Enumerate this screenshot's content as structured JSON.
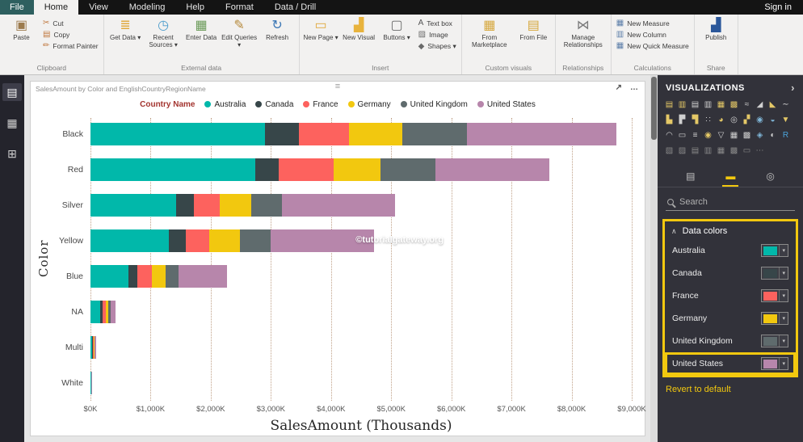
{
  "titlebar": {
    "file_tab": "File",
    "tabs": [
      "Home",
      "View",
      "Modeling",
      "Help",
      "Format",
      "Data / Drill"
    ],
    "active_tab": "Home",
    "sign_in": "Sign in"
  },
  "ribbon": {
    "groups": [
      {
        "label": "Clipboard",
        "buttons": [
          {
            "label": "Paste",
            "size": "large",
            "icon": "paste-icon",
            "glyph": "▣",
            "color": "#9c7b4e",
            "caret": false
          },
          {
            "label": "Cut",
            "size": "small",
            "icon": "cut-icon",
            "glyph": "✂",
            "color": "#c0773d",
            "caret": false
          },
          {
            "label": "Copy",
            "size": "small",
            "icon": "copy-icon",
            "glyph": "▤",
            "color": "#c0773d",
            "caret": false
          },
          {
            "label": "Format Painter",
            "size": "small",
            "icon": "format-painter-icon",
            "glyph": "✏",
            "color": "#c0773d",
            "caret": false
          }
        ]
      },
      {
        "label": "External data",
        "buttons": [
          {
            "label": "Get Data",
            "size": "large",
            "icon": "get-data-icon",
            "glyph": "≣",
            "color": "#e0a93e",
            "caret": true
          },
          {
            "label": "Recent Sources",
            "size": "large",
            "icon": "recent-sources-icon",
            "glyph": "◷",
            "color": "#4a9ccc",
            "caret": true
          },
          {
            "label": "Enter Data",
            "size": "large",
            "icon": "enter-data-icon",
            "glyph": "▦",
            "color": "#6a9a58",
            "caret": false
          },
          {
            "label": "Edit Queries",
            "size": "large",
            "icon": "edit-queries-icon",
            "glyph": "✎",
            "color": "#b5893a",
            "caret": true
          },
          {
            "label": "Refresh",
            "size": "large",
            "icon": "refresh-icon",
            "glyph": "↻",
            "color": "#3a76b5",
            "caret": false
          }
        ]
      },
      {
        "label": "Insert",
        "buttons": [
          {
            "label": "New Page",
            "size": "large",
            "icon": "new-page-icon",
            "glyph": "▭",
            "color": "#e0a93e",
            "caret": true
          },
          {
            "label": "New Visual",
            "size": "large",
            "icon": "new-visual-icon",
            "glyph": "▟",
            "color": "#e8b33d",
            "caret": false
          },
          {
            "label": "Buttons",
            "size": "large",
            "icon": "buttons-icon",
            "glyph": "▢",
            "color": "#6a6a6a",
            "caret": true
          },
          {
            "label": "Text box",
            "size": "small",
            "icon": "text-box-icon",
            "glyph": "A",
            "color": "#555555",
            "caret": false
          },
          {
            "label": "Image",
            "size": "small",
            "icon": "image-icon",
            "glyph": "▨",
            "color": "#6a6a6a",
            "caret": false
          },
          {
            "label": "Shapes",
            "size": "small",
            "icon": "shapes-icon",
            "glyph": "◆",
            "color": "#6a6a6a",
            "caret": true
          }
        ]
      },
      {
        "label": "Custom visuals",
        "buttons": [
          {
            "label": "From Marketplace",
            "size": "large",
            "icon": "from-marketplace-icon",
            "glyph": "▦",
            "color": "#d6a73c",
            "caret": false
          },
          {
            "label": "From File",
            "size": "large",
            "icon": "from-file-icon",
            "glyph": "▤",
            "color": "#d6a73c",
            "caret": false
          }
        ]
      },
      {
        "label": "Relationships",
        "buttons": [
          {
            "label": "Manage Relationships",
            "size": "large",
            "icon": "manage-relationships-icon",
            "glyph": "⋈",
            "color": "#7a7a7a",
            "caret": false
          }
        ]
      },
      {
        "label": "Calculations",
        "buttons": [
          {
            "label": "New Measure",
            "size": "small",
            "icon": "new-measure-icon",
            "glyph": "▦",
            "color": "#5b7da8",
            "caret": false
          },
          {
            "label": "New Column",
            "size": "small",
            "icon": "new-column-icon",
            "glyph": "▥",
            "color": "#5b7da8",
            "caret": false
          },
          {
            "label": "New Quick Measure",
            "size": "small",
            "icon": "new-quick-measure-icon",
            "glyph": "▦",
            "color": "#5b7da8",
            "caret": false
          }
        ]
      },
      {
        "label": "Share",
        "buttons": [
          {
            "label": "Publish",
            "size": "large",
            "icon": "publish-icon",
            "glyph": "▟",
            "color": "#2b579a",
            "caret": false
          }
        ]
      }
    ]
  },
  "sidebar": {
    "items": [
      {
        "name": "report-view",
        "glyph": "▤"
      },
      {
        "name": "data-view",
        "glyph": "▦"
      },
      {
        "name": "model-view",
        "glyph": "⊞"
      }
    ]
  },
  "canvas": {
    "visual_title": "SalesAmount by Color and EnglishCountryRegionName",
    "focus_icon": "↗",
    "more_options": "…",
    "drag_handle": "≡"
  },
  "chart_data": {
    "type": "bar",
    "orientation": "horizontal",
    "stacked": true,
    "title": "SalesAmount by Color and EnglishCountryRegionName",
    "legend_title": "Country Name",
    "legend_title_color": "#A3342F",
    "legend_position": "top-center",
    "grid": "vertical-dotted",
    "categories": [
      "Black",
      "Red",
      "Silver",
      "Yellow",
      "Blue",
      "NA",
      "Multi",
      "White"
    ],
    "series": [
      {
        "name": "Australia",
        "color": "#01B8AA",
        "values": [
          2900,
          2740,
          1430,
          1300,
          630,
          160,
          30,
          8
        ]
      },
      {
        "name": "Canada",
        "color": "#374649",
        "values": [
          570,
          390,
          290,
          290,
          150,
          40,
          10,
          2
        ]
      },
      {
        "name": "France",
        "color": "#FD625E",
        "values": [
          830,
          910,
          430,
          390,
          240,
          50,
          12,
          3
        ]
      },
      {
        "name": "Germany",
        "color": "#F2C80F",
        "values": [
          880,
          780,
          520,
          500,
          230,
          50,
          12,
          3
        ]
      },
      {
        "name": "United Kingdom",
        "color": "#5F6B6D",
        "values": [
          1080,
          920,
          520,
          520,
          210,
          40,
          10,
          2
        ]
      },
      {
        "name": "United States",
        "color": "#B786AB",
        "values": [
          2480,
          1890,
          1870,
          1720,
          810,
          80,
          20,
          5
        ]
      }
    ],
    "xlabel": "SalesAmount (Thousands)",
    "ylabel": "Color",
    "xlim": [
      0,
      9000
    ],
    "x_ticks": [
      "$0K",
      "$1,000K",
      "$2,000K",
      "$3,000K",
      "$4,000K",
      "$5,000K",
      "$6,000K",
      "$7,000K",
      "$8,000K",
      "$9,000K"
    ],
    "watermark": "©tutorialgateway.org"
  },
  "panel": {
    "title": "VISUALIZATIONS",
    "chevron": "›",
    "viz_icons": [
      {
        "name": "stacked-bar-chart",
        "glyph": "▤",
        "color": "#e4c867"
      },
      {
        "name": "stacked-column-chart",
        "glyph": "▥",
        "color": "#e4c867"
      },
      {
        "name": "clustered-bar-chart",
        "glyph": "▤",
        "color": "#d0d0d0"
      },
      {
        "name": "clustered-column-chart",
        "glyph": "▥",
        "color": "#d0d0d0"
      },
      {
        "name": "100-stacked-bar-chart",
        "glyph": "▦",
        "color": "#e4c867"
      },
      {
        "name": "100-stacked-column-chart",
        "glyph": "▩",
        "color": "#e4c867"
      },
      {
        "name": "line-chart",
        "glyph": "≈",
        "color": "#d0d0d0"
      },
      {
        "name": "area-chart",
        "glyph": "◢",
        "color": "#d0d0d0"
      },
      {
        "name": "stacked-area-chart",
        "glyph": "◣",
        "color": "#e4c867"
      },
      {
        "name": "ribbon-chart",
        "glyph": "∼",
        "color": "#d0d0d0"
      },
      {
        "name": "line-and-stacked-column-chart",
        "glyph": "▙",
        "color": "#e4c867"
      },
      {
        "name": "line-and-clustered-column-chart",
        "glyph": "▛",
        "color": "#d0d0d0"
      },
      {
        "name": "waterfall-chart",
        "glyph": "▜",
        "color": "#e4c867"
      },
      {
        "name": "scatter-chart",
        "glyph": "∷",
        "color": "#d0d0d0"
      },
      {
        "name": "pie-chart",
        "glyph": "◕",
        "color": "#e4c867"
      },
      {
        "name": "donut-chart",
        "glyph": "◎",
        "color": "#d0d0d0"
      },
      {
        "name": "treemap",
        "glyph": "▞",
        "color": "#e4c867"
      },
      {
        "name": "map",
        "glyph": "◉",
        "color": "#7fb5d6"
      },
      {
        "name": "filled-map",
        "glyph": "◒",
        "color": "#7fb5d6"
      },
      {
        "name": "funnel",
        "glyph": "▼",
        "color": "#e4c867"
      },
      {
        "name": "gauge",
        "glyph": "◠",
        "color": "#d0d0d0"
      },
      {
        "name": "card",
        "glyph": "▭",
        "color": "#d0d0d0"
      },
      {
        "name": "multi-row-card",
        "glyph": "≡",
        "color": "#d0d0d0"
      },
      {
        "name": "kpi",
        "glyph": "◉",
        "color": "#e4c867"
      },
      {
        "name": "slicer",
        "glyph": "▽",
        "color": "#d0d0d0"
      },
      {
        "name": "table",
        "glyph": "▦",
        "color": "#d0d0d0"
      },
      {
        "name": "matrix",
        "glyph": "▩",
        "color": "#d0d0d0"
      },
      {
        "name": "arcgis-map",
        "glyph": "◈",
        "color": "#7fb5d6"
      },
      {
        "name": "shape-map",
        "glyph": "◐",
        "color": "#d0d0d0"
      },
      {
        "name": "r-script-visual",
        "glyph": "R",
        "color": "#4ba3d9"
      },
      {
        "name": "custom-visual-1",
        "glyph": "▧",
        "color": "#8a8a8a"
      },
      {
        "name": "custom-visual-2",
        "glyph": "▨",
        "color": "#8a8a8a"
      },
      {
        "name": "custom-visual-3",
        "glyph": "▤",
        "color": "#8a8a8a"
      },
      {
        "name": "custom-visual-4",
        "glyph": "▥",
        "color": "#8a8a8a"
      },
      {
        "name": "custom-visual-5",
        "glyph": "▦",
        "color": "#8a8a8a"
      },
      {
        "name": "custom-visual-6",
        "glyph": "▩",
        "color": "#8a8a8a"
      },
      {
        "name": "custom-visual-7",
        "glyph": "▭",
        "color": "#8a8a8a"
      },
      {
        "name": "get-more-visuals",
        "glyph": "⋯",
        "color": "#8a8a8a"
      }
    ],
    "tabs": [
      {
        "name": "fields",
        "glyph": "▤",
        "active": false
      },
      {
        "name": "format",
        "glyph": "▬",
        "active": true
      },
      {
        "name": "analytics",
        "glyph": "◎",
        "active": false
      }
    ],
    "search_placeholder": "Search",
    "data_colors": {
      "header": "Data colors",
      "caret": "∧",
      "items": [
        {
          "label": "Australia",
          "color": "#01B8AA",
          "highlighted": false
        },
        {
          "label": "Canada",
          "color": "#374649",
          "highlighted": false
        },
        {
          "label": "France",
          "color": "#FD625E",
          "highlighted": false
        },
        {
          "label": "Germany",
          "color": "#F2C80F",
          "highlighted": false
        },
        {
          "label": "United Kingdom",
          "color": "#5F6B6D",
          "highlighted": false
        },
        {
          "label": "United States",
          "color": "#B786AB",
          "highlighted": true
        }
      ],
      "revert_label": "Revert to default"
    },
    "highlight_color": "#F2C80F"
  }
}
